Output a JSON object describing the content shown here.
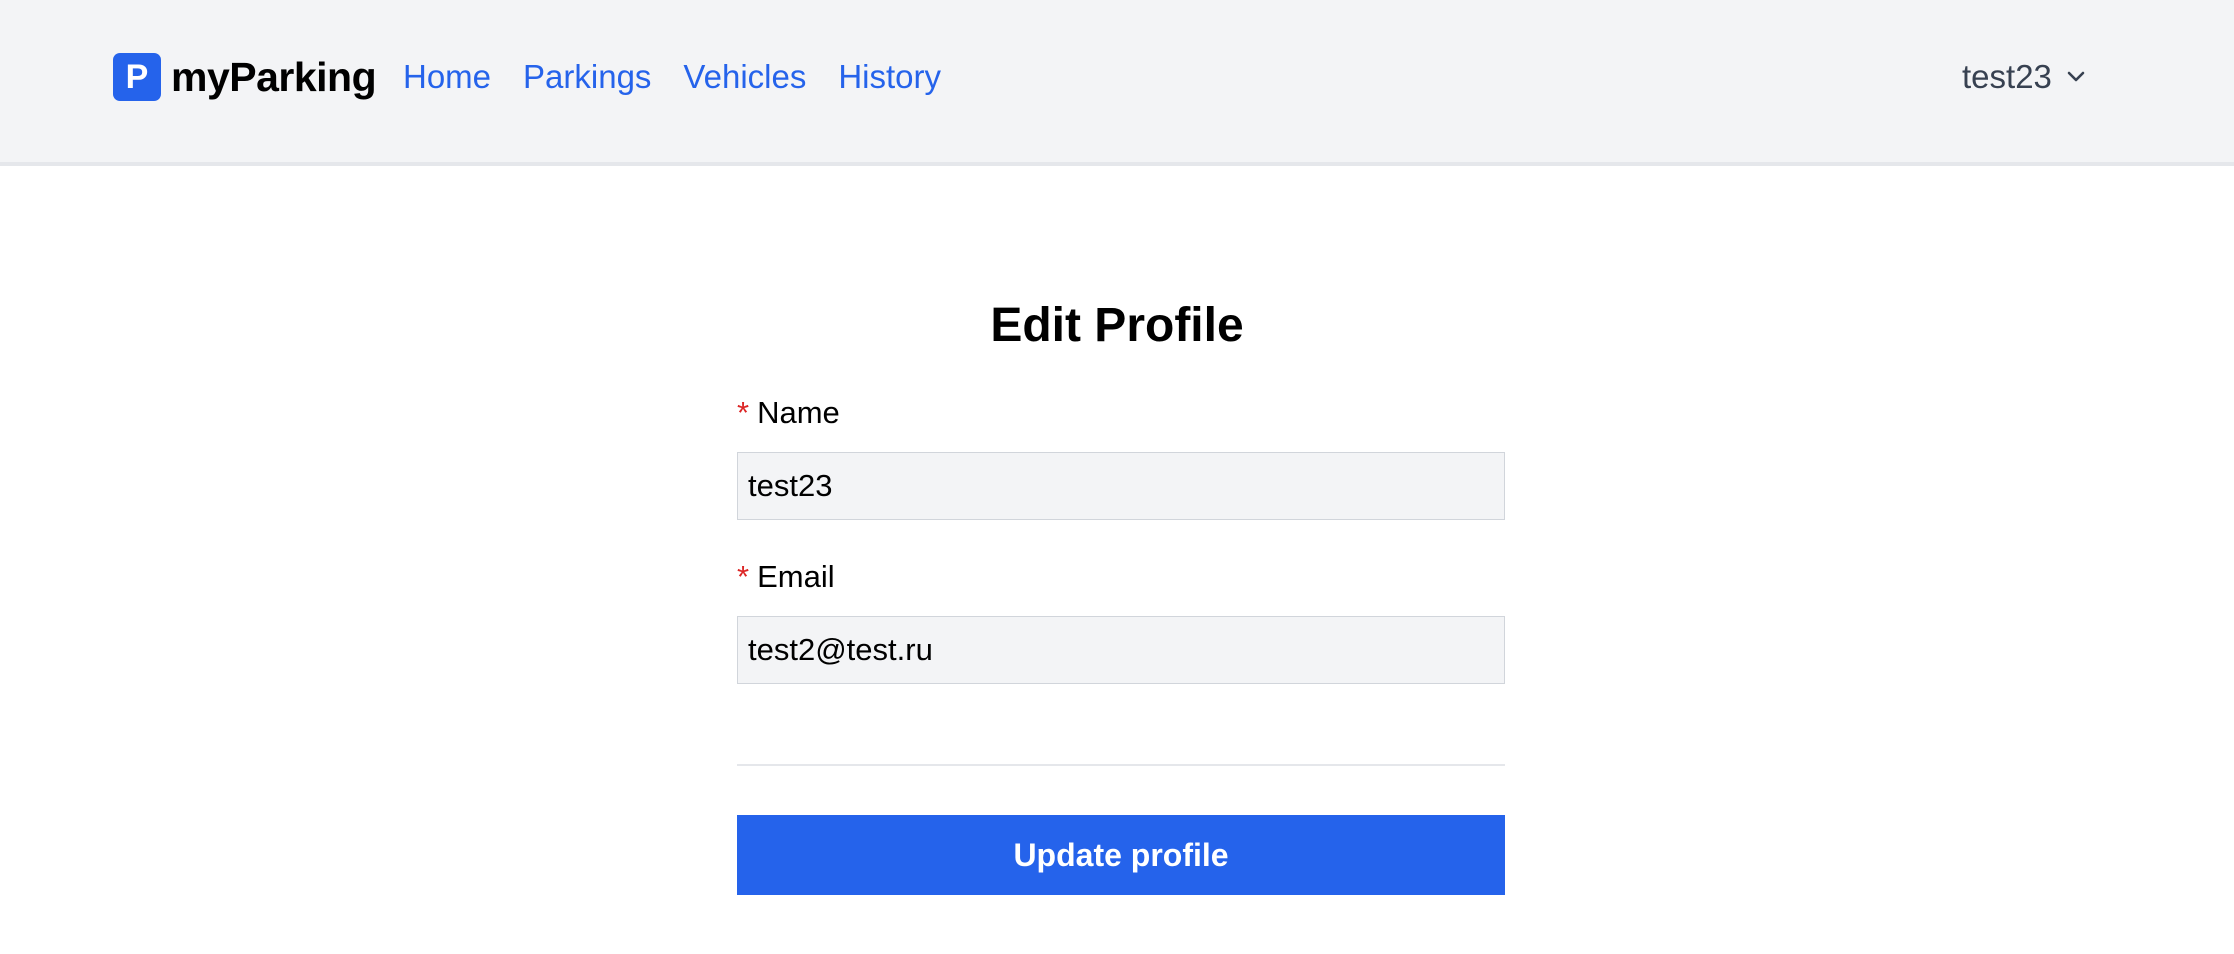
{
  "header": {
    "logo_letter": "P",
    "app_name": "myParking",
    "nav": [
      {
        "label": "Home"
      },
      {
        "label": "Parkings"
      },
      {
        "label": "Vehicles"
      },
      {
        "label": "History"
      }
    ],
    "user_name": "test23",
    "user_menu_icon": "chevron-down-icon"
  },
  "form": {
    "title": "Edit Profile",
    "required_marker": "*",
    "name_label": "Name",
    "name_value": "test23",
    "email_label": "Email",
    "email_value": "test2@test.ru",
    "submit_label": "Update profile"
  },
  "colors": {
    "accent": "#2563eb",
    "required": "#dc2626",
    "header_bg": "#f3f4f6"
  }
}
